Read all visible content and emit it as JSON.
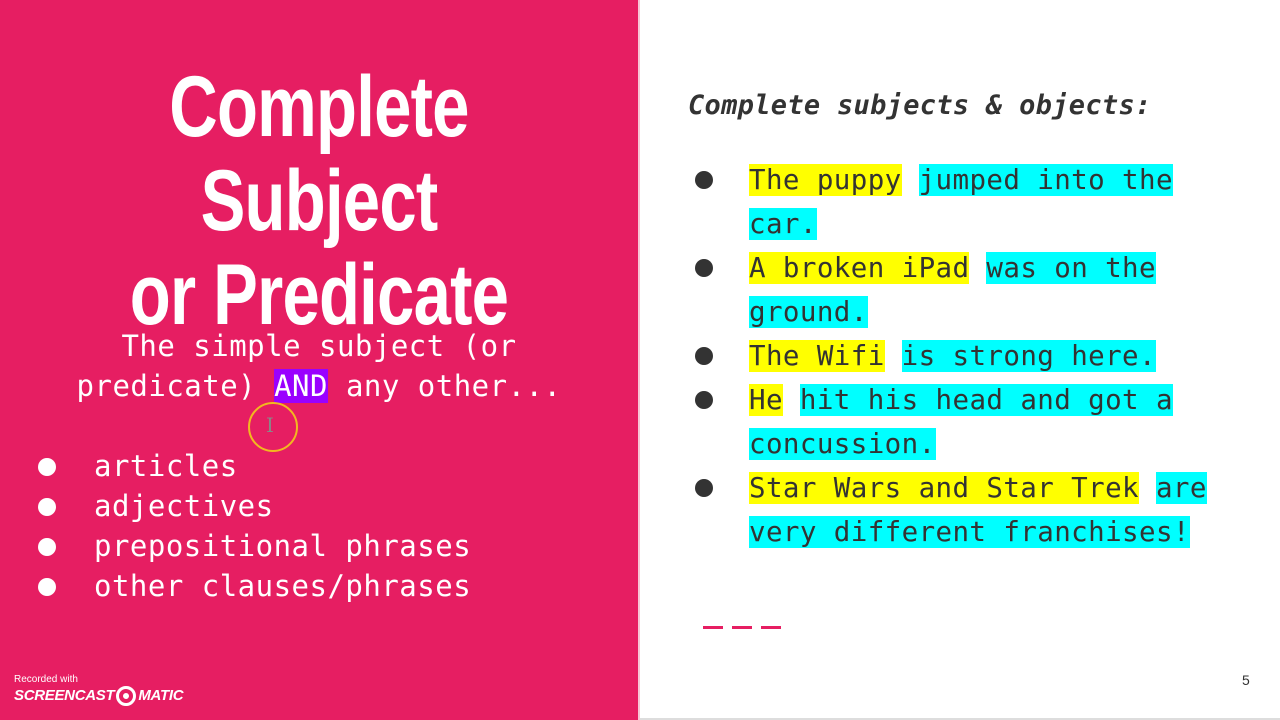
{
  "slide": {
    "page_number": "5",
    "colors": {
      "left_panel": "#e61e62",
      "and_highlight": "#9a00ff",
      "subject_highlight": "#ffff00",
      "predicate_highlight": "#00ffff",
      "text_dark": "#333333"
    }
  },
  "left": {
    "title_line1": "Complete Subject",
    "title_line2": "or Predicate",
    "intro_line1": "The simple subject (or",
    "intro_line2_before": "predicate) ",
    "intro_highlight": "AND",
    "intro_line2_after": " any other...",
    "list": [
      {
        "label": "articles"
      },
      {
        "label": "adjectives"
      },
      {
        "label": "prepositional phrases"
      },
      {
        "label": "other clauses/phrases"
      }
    ]
  },
  "right": {
    "heading": "Complete subjects & objects:",
    "examples": [
      {
        "subject": "The puppy",
        "predicate": "jumped into the car."
      },
      {
        "subject": "A broken iPad",
        "predicate": "was on the ground."
      },
      {
        "subject": "The Wifi",
        "predicate": "is strong here."
      },
      {
        "subject": "He",
        "predicate": "hit his head and got a concussion."
      },
      {
        "subject": "Star Wars and Star Trek",
        "predicate": "are very different franchises!"
      }
    ]
  },
  "watermark": {
    "small": "Recorded with",
    "brand_left": "SCREENCAST",
    "brand_right": "MATIC"
  },
  "cursor": {
    "icon": "i-beam-cursor-icon"
  }
}
